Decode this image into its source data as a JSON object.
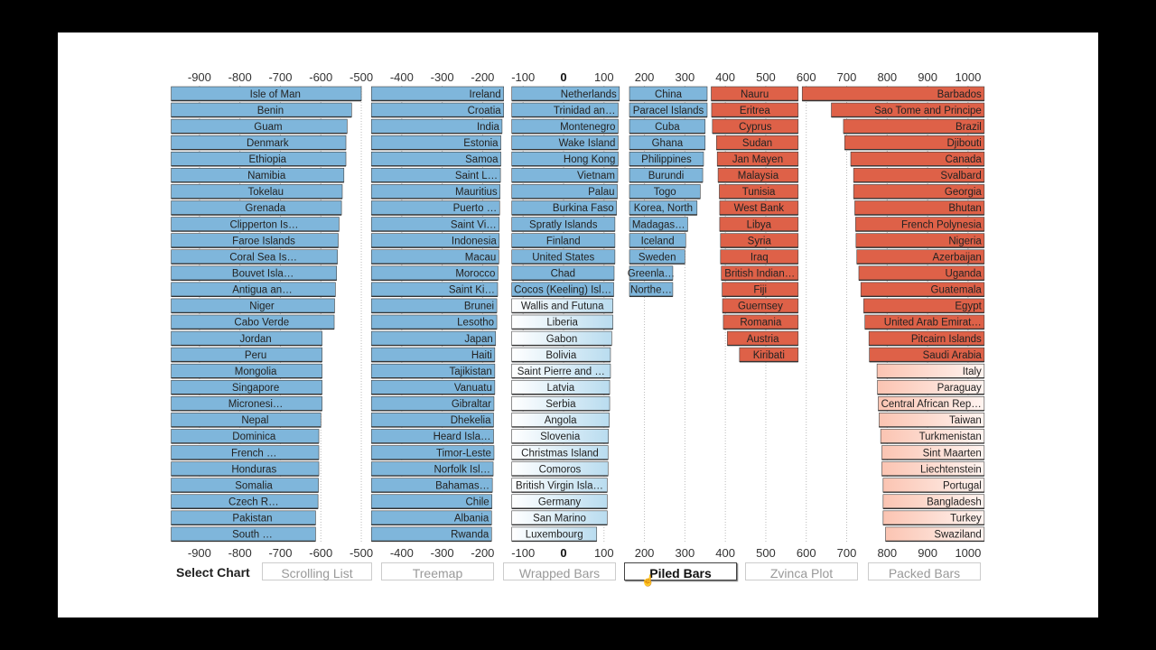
{
  "chart_data": {
    "type": "bar",
    "variant": "piled-bars",
    "title": "",
    "xlabel": "",
    "ylabel": "",
    "xlim": [
      -970,
      1040
    ],
    "x_ticks": [
      -900,
      -800,
      -700,
      -600,
      -500,
      -400,
      -300,
      -200,
      -100,
      0,
      100,
      200,
      300,
      400,
      500,
      600,
      700,
      800,
      900,
      1000
    ],
    "grid": true,
    "colors": {
      "negative": "#7fb6db",
      "positive": "#de6148",
      "pale_negative_start": "#ffffff",
      "pale_positive_start": "#fde0d6"
    },
    "columns": [
      {
        "side": "negative",
        "style": "solid",
        "start": -970,
        "items": [
          {
            "name": "Isle of Man",
            "value": -500
          },
          {
            "name": "Benin",
            "value": -524
          },
          {
            "name": "Guam",
            "value": -535
          },
          {
            "name": "Denmark",
            "value": -538
          },
          {
            "name": "Ethiopia",
            "value": -538
          },
          {
            "name": "Namibia",
            "value": -543
          },
          {
            "name": "Tokelau",
            "value": -547
          },
          {
            "name": "Grenada",
            "value": -549
          },
          {
            "name": "Clipperton Is…",
            "value": -555
          },
          {
            "name": "Faroe Islands",
            "value": -557
          },
          {
            "name": "Coral Sea Is…",
            "value": -559
          },
          {
            "name": "Bouvet Isla…",
            "value": -561
          },
          {
            "name": "Antigua an…",
            "value": -564
          },
          {
            "name": "Niger",
            "value": -566
          },
          {
            "name": "Cabo Verde",
            "value": -567
          },
          {
            "name": "Jordan",
            "value": -597
          },
          {
            "name": "Peru",
            "value": -597
          },
          {
            "name": "Mongolia",
            "value": -597
          },
          {
            "name": "Singapore",
            "value": -597
          },
          {
            "name": "Micronesi…",
            "value": -597
          },
          {
            "name": "Nepal",
            "value": -600
          },
          {
            "name": "Dominica",
            "value": -605
          },
          {
            "name": "French …",
            "value": -605
          },
          {
            "name": "Honduras",
            "value": -605
          },
          {
            "name": "Somalia",
            "value": -606
          },
          {
            "name": "Czech R…",
            "value": -607
          },
          {
            "name": "Pakistan",
            "value": -613
          },
          {
            "name": "South …",
            "value": -613
          }
        ]
      },
      {
        "side": "negative",
        "style": "solid",
        "start": -475,
        "items": [
          {
            "name": "Ireland",
            "value": -148
          },
          {
            "name": "Croatia",
            "value": -148
          },
          {
            "name": "India",
            "value": -152
          },
          {
            "name": "Estonia",
            "value": -155
          },
          {
            "name": "Samoa",
            "value": -155
          },
          {
            "name": "Saint L…",
            "value": -156
          },
          {
            "name": "Mauritius",
            "value": -157
          },
          {
            "name": "Puerto …",
            "value": -158
          },
          {
            "name": "Saint Vi…",
            "value": -159
          },
          {
            "name": "Indonesia",
            "value": -159
          },
          {
            "name": "Macau",
            "value": -160
          },
          {
            "name": "Morocco",
            "value": -162
          },
          {
            "name": "Saint Ki…",
            "value": -163
          },
          {
            "name": "Brunei",
            "value": -165
          },
          {
            "name": "Lesotho",
            "value": -165
          },
          {
            "name": "Japan",
            "value": -168
          },
          {
            "name": "Haiti",
            "value": -170
          },
          {
            "name": "Tajikistan",
            "value": -170
          },
          {
            "name": "Vanuatu",
            "value": -170
          },
          {
            "name": "Gibraltar",
            "value": -172
          },
          {
            "name": "Dhekelia",
            "value": -173
          },
          {
            "name": "Heard Isla…",
            "value": -173
          },
          {
            "name": "Timor-Leste",
            "value": -172
          },
          {
            "name": "Norfolk Isl…",
            "value": -174
          },
          {
            "name": "Bahamas…",
            "value": -176
          },
          {
            "name": "Chile",
            "value": -177
          },
          {
            "name": "Albania",
            "value": -178
          },
          {
            "name": "Rwanda",
            "value": -178
          }
        ]
      },
      {
        "side": "negative",
        "style": "mixed",
        "start": -128,
        "items": [
          {
            "name": "Netherlands",
            "value": 138
          },
          {
            "name": "Trinidad an…",
            "value": 135
          },
          {
            "name": "Montenegro",
            "value": 135
          },
          {
            "name": "Wake Island",
            "value": 135
          },
          {
            "name": "Hong Kong",
            "value": 135
          },
          {
            "name": "Vietnam",
            "value": 134
          },
          {
            "name": "Palau",
            "value": 133
          },
          {
            "name": "Burkina Faso",
            "value": 131
          },
          {
            "name": "Spratly Islands",
            "value": 127
          },
          {
            "name": "Finland",
            "value": 127
          },
          {
            "name": "United States",
            "value": 127
          },
          {
            "name": "Chad",
            "value": 125
          },
          {
            "name": "Cocos (Keeling) Isl…",
            "value": 124
          },
          {
            "name": "Wallis and Futuna",
            "value": 122,
            "pale": true
          },
          {
            "name": "Liberia",
            "value": 122,
            "pale": true
          },
          {
            "name": "Gabon",
            "value": 119,
            "pale": true
          },
          {
            "name": "Bolivia",
            "value": 116,
            "pale": true
          },
          {
            "name": "Saint Pierre and …",
            "value": 116,
            "pale": true
          },
          {
            "name": "Latvia",
            "value": 114,
            "pale": true
          },
          {
            "name": "Serbia",
            "value": 114,
            "pale": true
          },
          {
            "name": "Angola",
            "value": 113,
            "pale": true
          },
          {
            "name": "Slovenia",
            "value": 111,
            "pale": true
          },
          {
            "name": "Christmas Island",
            "value": 110,
            "pale": true
          },
          {
            "name": "Comoros",
            "value": 110,
            "pale": true
          },
          {
            "name": "British Virgin Isla…",
            "value": 108,
            "pale": true
          },
          {
            "name": "Germany",
            "value": 108,
            "pale": true
          },
          {
            "name": "San Marino",
            "value": 108,
            "pale": true
          },
          {
            "name": "Luxembourg",
            "value": 82,
            "pale": true
          }
        ]
      },
      {
        "side": "negative",
        "style": "solid",
        "start": 163,
        "items": [
          {
            "name": "China",
            "value": 355
          },
          {
            "name": "Paracel Islands",
            "value": 355
          },
          {
            "name": "Cuba",
            "value": 350
          },
          {
            "name": "Ghana",
            "value": 350
          },
          {
            "name": "Philippines",
            "value": 346
          },
          {
            "name": "Burundi",
            "value": 344
          },
          {
            "name": "Togo",
            "value": 338
          },
          {
            "name": "Korea, North",
            "value": 330
          },
          {
            "name": "Madagas…",
            "value": 307
          },
          {
            "name": "Iceland",
            "value": 302
          },
          {
            "name": "Sweden",
            "value": 300
          },
          {
            "name": "Greenla…",
            "value": 270
          },
          {
            "name": "Northe…",
            "value": 270
          }
        ]
      },
      {
        "side": "positive",
        "style": "solid",
        "end": 580,
        "items": [
          {
            "name": "Nauru",
            "value": 365
          },
          {
            "name": "Eritrea",
            "value": 366
          },
          {
            "name": "Cyprus",
            "value": 368
          },
          {
            "name": "Sudan",
            "value": 378
          },
          {
            "name": "Jan Mayen",
            "value": 380
          },
          {
            "name": "Malaysia",
            "value": 382
          },
          {
            "name": "Tunisia",
            "value": 385
          },
          {
            "name": "West Bank",
            "value": 386
          },
          {
            "name": "Libya",
            "value": 386
          },
          {
            "name": "Syria",
            "value": 388
          },
          {
            "name": "Iraq",
            "value": 388
          },
          {
            "name": "British Indian…",
            "value": 390
          },
          {
            "name": "Fiji",
            "value": 392
          },
          {
            "name": "Guernsey",
            "value": 393
          },
          {
            "name": "Romania",
            "value": 395
          },
          {
            "name": "Austria",
            "value": 405
          },
          {
            "name": "Kiribati",
            "value": 435
          }
        ]
      },
      {
        "side": "positive",
        "style": "mixed",
        "end": 1040,
        "items": [
          {
            "name": "Barbados",
            "value": 590
          },
          {
            "name": "Sao Tome and Principe",
            "value": 662
          },
          {
            "name": "Brazil",
            "value": 692
          },
          {
            "name": "Djibouti",
            "value": 695
          },
          {
            "name": "Canada",
            "value": 710
          },
          {
            "name": "Svalbard",
            "value": 717
          },
          {
            "name": "Georgia",
            "value": 717
          },
          {
            "name": "Bhutan",
            "value": 720
          },
          {
            "name": "French Polynesia",
            "value": 722
          },
          {
            "name": "Nigeria",
            "value": 723
          },
          {
            "name": "Azerbaijan",
            "value": 725
          },
          {
            "name": "Uganda",
            "value": 730
          },
          {
            "name": "Guatemala",
            "value": 735
          },
          {
            "name": "Egypt",
            "value": 742
          },
          {
            "name": "United Arab Emirat…",
            "value": 745
          },
          {
            "name": "Pitcairn Islands",
            "value": 755
          },
          {
            "name": "Saudi Arabia",
            "value": 756
          },
          {
            "name": "Italy",
            "value": 775,
            "pale": true
          },
          {
            "name": "Paraguay",
            "value": 776,
            "pale": true
          },
          {
            "name": "Central African Rep…",
            "value": 778,
            "pale": true
          },
          {
            "name": "Taiwan",
            "value": 780,
            "pale": true
          },
          {
            "name": "Turkmenistan",
            "value": 784,
            "pale": true
          },
          {
            "name": "Sint Maarten",
            "value": 787,
            "pale": true
          },
          {
            "name": "Liechtenstein",
            "value": 787,
            "pale": true
          },
          {
            "name": "Portugal",
            "value": 790,
            "pale": true
          },
          {
            "name": "Bangladesh",
            "value": 790,
            "pale": true
          },
          {
            "name": "Turkey",
            "value": 790,
            "pale": true
          },
          {
            "name": "Swaziland",
            "value": 796,
            "pale": true
          }
        ]
      }
    ]
  },
  "controls": {
    "label": "Select Chart",
    "buttons": [
      {
        "label": "Scrolling List",
        "active": false
      },
      {
        "label": "Treemap",
        "active": false
      },
      {
        "label": "Wrapped Bars",
        "active": false
      },
      {
        "label": "Piled Bars",
        "active": true
      },
      {
        "label": "Zvinca Plot",
        "active": false
      },
      {
        "label": "Packed Bars",
        "active": false
      }
    ]
  }
}
